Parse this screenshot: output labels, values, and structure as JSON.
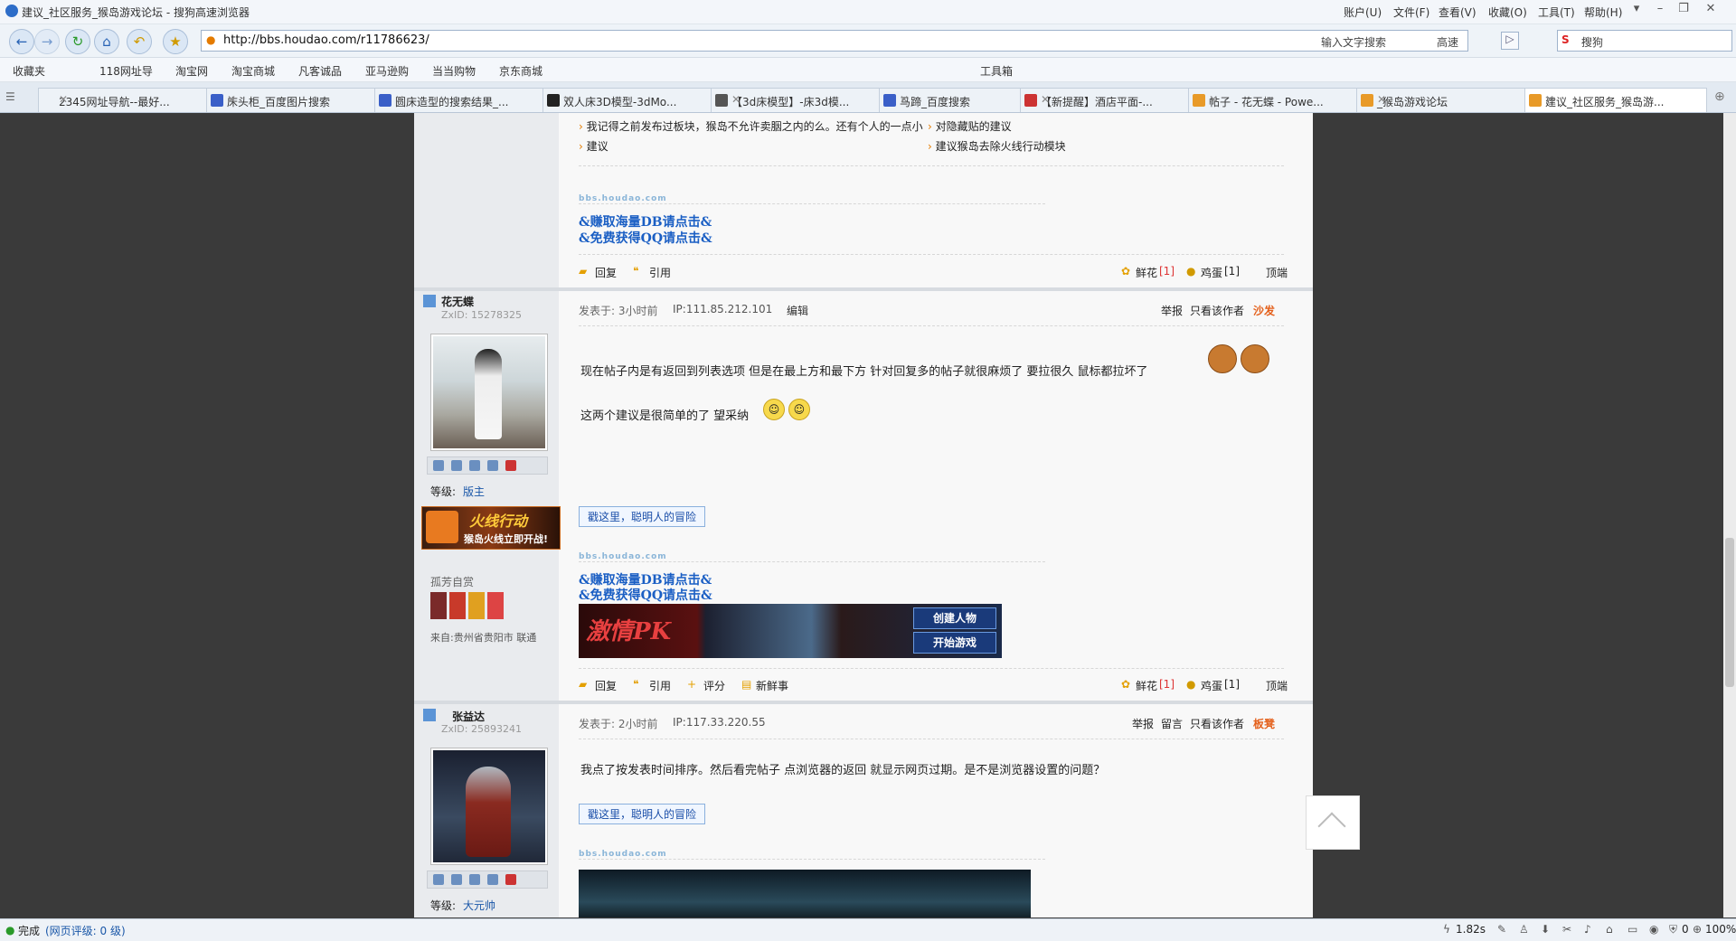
{
  "window": {
    "title": "建议_社区服务_猴岛游戏论坛 - 搜狗高速浏览器",
    "menu": [
      "账户(U)",
      "文件(F)",
      "查看(V)",
      "收藏(O)",
      "工具(T)",
      "帮助(H)"
    ]
  },
  "nav": {
    "url": "http://bbs.houdao.com/r11786623/",
    "input_hint": "输入文字搜索",
    "speed_label": "高速",
    "search_placeholder": "搜狗"
  },
  "bookmarks": {
    "items": [
      "收藏夹",
      "118网址导",
      "淘宝网",
      "淘宝商城",
      "凡客诚品",
      "亚马逊购",
      "当当购物",
      "京东商城"
    ],
    "toolbox": "工具箱"
  },
  "tabs": [
    {
      "label": "2345网址导航--最好..."
    },
    {
      "label": "床头柜_百度图片搜索"
    },
    {
      "label": "圆床造型的搜索结果_..."
    },
    {
      "label": "双人床3D模型-3dMo..."
    },
    {
      "label": "【3d床模型】-床3d模..."
    },
    {
      "label": "马蹄_百度搜索"
    },
    {
      "label": "【新提醒】酒店平面-..."
    },
    {
      "label": "帖子 - 花无蝶 - Powe..."
    },
    {
      "label": "_猴岛游戏论坛"
    },
    {
      "label": "建议_社区服务_猴岛游..."
    }
  ],
  "prev_post": {
    "related": [
      "我记得之前发布过板块，猴岛不允许卖胭之内的么。还有个人的一点小",
      "对隐藏贴的建议",
      "建议",
      "建议猴岛去除火线行动模块"
    ],
    "watermark": "bbs.houdao.com",
    "promo1": "&赚取海量DB请点击&",
    "promo2": "&免费获得QQ请点击&",
    "actions": {
      "reply": "回复",
      "quote": "引用",
      "flower": "鲜花",
      "flower_count": "[1]",
      "egg": "鸡蛋",
      "egg_count": "[1]",
      "top": "顶端"
    }
  },
  "post1": {
    "author": "花无蝶",
    "zxid": "ZxID: 15278325",
    "level_label": "等级:",
    "level": "版主",
    "game_banner_title": "火线行动",
    "game_banner_sub": "猴岛火线立即开战!",
    "medal_label": "孤芳自赏",
    "from": "来自:贵州省贵阳市 联通",
    "time": "发表于: 3小时前",
    "ip": "IP:111.85.212.101",
    "edit": "编辑",
    "report": "举报",
    "only_author": "只看该作者",
    "floor": "沙发",
    "body1": "现在帖子内是有返回到列表选项  但是在最上方和最下方 针对回复多的帖子就很麻烦了 要拉很久 鼠标都拉坏了",
    "body2": "这两个建议是很简单的了 望采纳",
    "ad_link": "戳这里，聪明人的冒险",
    "watermark": "bbs.houdao.com",
    "promo1": "&赚取海量DB请点击&",
    "promo2": "&免费获得QQ请点击&",
    "banner_title": "激情PK",
    "banner_btn1": "创建人物",
    "banner_btn2": "开始游戏",
    "actions": {
      "reply": "回复",
      "quote": "引用",
      "rate": "评分",
      "news": "新鲜事",
      "flower": "鲜花",
      "flower_count": "[1]",
      "egg": "鸡蛋",
      "egg_count": "[1]",
      "top": "顶端"
    }
  },
  "post2": {
    "author": "张益达",
    "zxid": "ZxID: 25893241",
    "level_label": "等级:",
    "level": "大元帅",
    "time": "发表于: 2小时前",
    "ip": "IP:117.33.220.55",
    "report": "举报",
    "message": "留言",
    "only_author": "只看该作者",
    "floor": "板凳",
    "body": "我点了按发表时间排序。然后看完帖子  点浏览器的返回  就显示网页过期。是不是浏览器设置的问题？",
    "ad_link": "戳这里，聪明人的冒险",
    "watermark": "bbs.houdao.com"
  },
  "status": {
    "done": "完成",
    "rating": "(网页评级: 0 级)",
    "time": "1.82s",
    "count": "0",
    "zoom": "100%"
  }
}
